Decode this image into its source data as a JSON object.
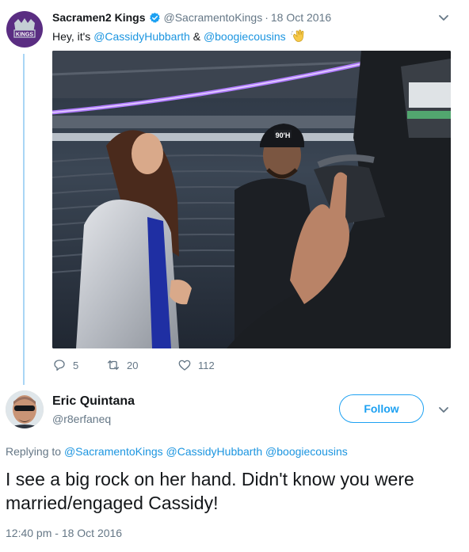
{
  "parent_tweet": {
    "avatar_text": "KINGS",
    "name": "Sacramen2 Kings",
    "handle": "@SacramentoKings",
    "separator": "·",
    "date": "18 Oct 2016",
    "text_intro": "Hey, it's ",
    "mention_1": "@CassidyHubbarth",
    "text_and": " & ",
    "mention_2": "@boogiecousins",
    "emoji": "waving-hand",
    "photo_cap_text": "90'H",
    "actions": {
      "reply_count": "5",
      "retweet_count": "20",
      "like_count": "112"
    }
  },
  "reply_tweet": {
    "name": "Eric Quintana",
    "handle": "@r8erfaneq",
    "follow_label": "Follow",
    "replying_label": "Replying to ",
    "replying_mentions": [
      "@SacramentoKings",
      "@CassidyHubbarth",
      "@boogiecousins"
    ],
    "text": "I see a big rock on her hand. Didn't know you were married/engaged Cassidy!",
    "timestamp": "12:40 pm - 18 Oct 2016"
  },
  "colors": {
    "link": "#1b95e0",
    "follow": "#1da1f2",
    "secondary_text": "#657786",
    "kings_purple": "#5a2d82",
    "thread_line": "#a9d6f5"
  }
}
